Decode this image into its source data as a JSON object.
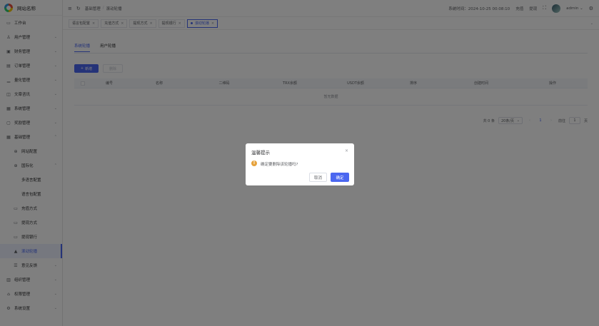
{
  "app": {
    "logo_text": "网站名称"
  },
  "sidebar": {
    "items": [
      {
        "label": "工作台",
        "icon": "monitor-icon"
      },
      {
        "label": "用户管理",
        "icon": "user-icon"
      },
      {
        "label": "财务管理",
        "icon": "wallet-icon"
      },
      {
        "label": "订单管理",
        "icon": "document-icon"
      },
      {
        "label": "量化管理",
        "icon": "chart-icon"
      },
      {
        "label": "文章咨讯",
        "icon": "article-icon"
      },
      {
        "label": "系统管理",
        "icon": "list-icon"
      },
      {
        "label": "奖励管理",
        "icon": "gift-icon"
      },
      {
        "label": "基础管理",
        "icon": "grid-icon"
      },
      {
        "label": "网站配置",
        "icon": "globe-icon"
      },
      {
        "label": "国际化",
        "icon": "globe-icon"
      },
      {
        "label": "多语言配置",
        "icon": ""
      },
      {
        "label": "语言包配置",
        "icon": ""
      },
      {
        "label": "充值方式",
        "icon": "card-icon"
      },
      {
        "label": "提现方式",
        "icon": "card-icon"
      },
      {
        "label": "提现银行",
        "icon": "bank-icon"
      },
      {
        "label": "滚动轮播",
        "icon": "image-icon"
      },
      {
        "label": "意见反馈",
        "icon": "feedback-icon"
      },
      {
        "label": "组织管理",
        "icon": "org-icon"
      },
      {
        "label": "权限管理",
        "icon": "lock-icon"
      },
      {
        "label": "系统设置",
        "icon": "gear-icon"
      }
    ]
  },
  "topbar": {
    "breadcrumb": [
      "基础管理",
      "滚动轮播"
    ],
    "system_time_label": "系统时间：",
    "system_time": "2024-10-25 00:08:10",
    "recharge": "充值",
    "withdraw": "提现",
    "username": "admin"
  },
  "tabs": [
    {
      "label": "语言包配置"
    },
    {
      "label": "充值方式"
    },
    {
      "label": "提现方式"
    },
    {
      "label": "提现银行"
    },
    {
      "label": "滚动轮播"
    }
  ],
  "content": {
    "inner_tabs": [
      "系统轮播",
      "用户轮播"
    ],
    "add_button": "新增",
    "delete_button": "删除",
    "columns": [
      "编号",
      "名称",
      "二维码",
      "TRX余额",
      "USDT余额",
      "排序",
      "创建时间",
      "操作"
    ],
    "empty_text": "暂无数据",
    "pager": {
      "total": "共 0 条",
      "page_size": "20条/页",
      "current_page": "1",
      "goto_label": "前往",
      "goto_value": "1",
      "page_suffix": "页"
    }
  },
  "dialog": {
    "title": "温馨提示",
    "message": "确定要删除该轮播吗?",
    "cancel": "取消",
    "confirm": "确定"
  },
  "colors": {
    "accent": "#4b67f0",
    "warning": "#e6a23c"
  }
}
